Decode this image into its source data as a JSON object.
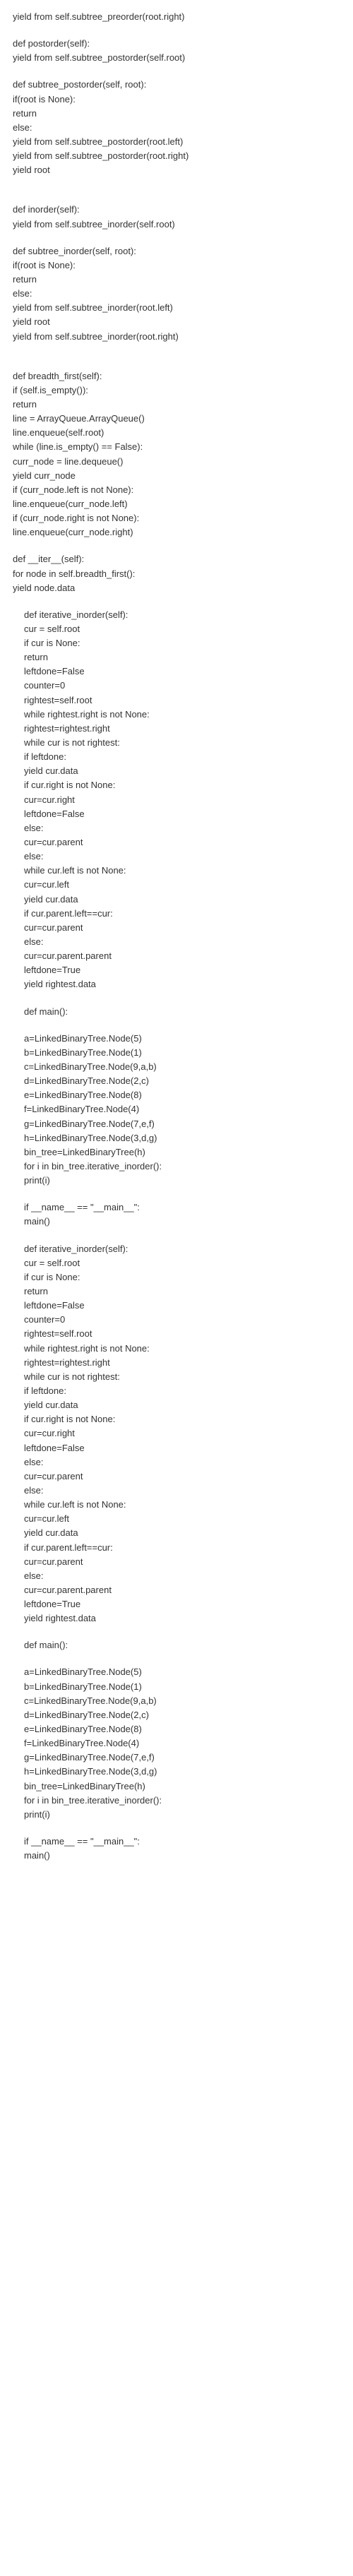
{
  "code": [
    {
      "t": "yield from self.subtree_preorder(root.right)",
      "i": 0
    },
    {
      "gap": true
    },
    {
      "t": "def postorder(self):",
      "i": 0
    },
    {
      "t": "yield from self.subtree_postorder(self.root)",
      "i": 0
    },
    {
      "gap": true
    },
    {
      "t": "def subtree_postorder(self, root):",
      "i": 0
    },
    {
      "t": "if(root is None):",
      "i": 0
    },
    {
      "t": "return",
      "i": 0
    },
    {
      "t": "else:",
      "i": 0
    },
    {
      "t": "yield from self.subtree_postorder(root.left)",
      "i": 0
    },
    {
      "t": "yield from self.subtree_postorder(root.right)",
      "i": 0
    },
    {
      "t": "yield root",
      "i": 0
    },
    {
      "gap": true
    },
    {
      "gap": true
    },
    {
      "t": "def inorder(self):",
      "i": 0
    },
    {
      "t": "yield from self.subtree_inorder(self.root)",
      "i": 0
    },
    {
      "gap": true
    },
    {
      "t": "def subtree_inorder(self, root):",
      "i": 0
    },
    {
      "t": "if(root is None):",
      "i": 0
    },
    {
      "t": "return",
      "i": 0
    },
    {
      "t": "else:",
      "i": 0
    },
    {
      "t": "yield from self.subtree_inorder(root.left)",
      "i": 0
    },
    {
      "t": "yield root",
      "i": 0
    },
    {
      "t": "yield from self.subtree_inorder(root.right)",
      "i": 0
    },
    {
      "gap": true
    },
    {
      "gap": true
    },
    {
      "t": "def breadth_first(self):",
      "i": 0
    },
    {
      "t": "if (self.is_empty()):",
      "i": 0
    },
    {
      "t": "return",
      "i": 0
    },
    {
      "t": "line = ArrayQueue.ArrayQueue()",
      "i": 0
    },
    {
      "t": "line.enqueue(self.root)",
      "i": 0
    },
    {
      "t": "while (line.is_empty() == False):",
      "i": 0
    },
    {
      "t": "curr_node = line.dequeue()",
      "i": 0
    },
    {
      "t": "yield curr_node",
      "i": 0
    },
    {
      "t": "if (curr_node.left is not None):",
      "i": 0
    },
    {
      "t": "line.enqueue(curr_node.left)",
      "i": 0
    },
    {
      "t": "if (curr_node.right is not None):",
      "i": 0
    },
    {
      "t": "line.enqueue(curr_node.right)",
      "i": 0
    },
    {
      "gap": true
    },
    {
      "t": "def __iter__(self):",
      "i": 0
    },
    {
      "t": "for node in self.breadth_first():",
      "i": 0
    },
    {
      "t": "yield node.data",
      "i": 0
    },
    {
      "gap": true
    },
    {
      "t": "def iterative_inorder(self):",
      "i": 1
    },
    {
      "t": "cur = self.root",
      "i": 1
    },
    {
      "t": "if cur is None:",
      "i": 1
    },
    {
      "t": "return",
      "i": 1
    },
    {
      "t": "leftdone=False",
      "i": 1
    },
    {
      "t": "counter=0",
      "i": 1
    },
    {
      "t": "rightest=self.root",
      "i": 1
    },
    {
      "t": "while rightest.right is not None:",
      "i": 1
    },
    {
      "t": "rightest=rightest.right",
      "i": 1
    },
    {
      "t": "while cur is not rightest:",
      "i": 1
    },
    {
      "t": "if leftdone:",
      "i": 1
    },
    {
      "t": "yield cur.data",
      "i": 1
    },
    {
      "t": "if cur.right is not None:",
      "i": 1
    },
    {
      "t": "cur=cur.right",
      "i": 1
    },
    {
      "t": "leftdone=False",
      "i": 1
    },
    {
      "t": "else:",
      "i": 1
    },
    {
      "t": "cur=cur.parent",
      "i": 1
    },
    {
      "t": "else:",
      "i": 1
    },
    {
      "t": "while cur.left is not None:",
      "i": 1
    },
    {
      "t": "cur=cur.left",
      "i": 1
    },
    {
      "t": "yield cur.data",
      "i": 1
    },
    {
      "t": "if cur.parent.left==cur:",
      "i": 1
    },
    {
      "t": "cur=cur.parent",
      "i": 1
    },
    {
      "t": "else:",
      "i": 1
    },
    {
      "t": "cur=cur.parent.parent",
      "i": 1
    },
    {
      "t": "leftdone=True",
      "i": 1
    },
    {
      "t": "yield rightest.data",
      "i": 1
    },
    {
      "gap": true
    },
    {
      "t": "def main():",
      "i": 1
    },
    {
      "gap": true
    },
    {
      "t": "a=LinkedBinaryTree.Node(5)",
      "i": 1
    },
    {
      "t": "b=LinkedBinaryTree.Node(1)",
      "i": 1
    },
    {
      "t": "c=LinkedBinaryTree.Node(9,a,b)",
      "i": 1
    },
    {
      "t": "d=LinkedBinaryTree.Node(2,c)",
      "i": 1
    },
    {
      "t": "e=LinkedBinaryTree.Node(8)",
      "i": 1
    },
    {
      "t": "f=LinkedBinaryTree.Node(4)",
      "i": 1
    },
    {
      "t": "g=LinkedBinaryTree.Node(7,e,f)",
      "i": 1
    },
    {
      "t": "h=LinkedBinaryTree.Node(3,d,g)",
      "i": 1
    },
    {
      "t": "bin_tree=LinkedBinaryTree(h)",
      "i": 1
    },
    {
      "t": "for i in bin_tree.iterative_inorder():",
      "i": 1
    },
    {
      "t": "print(i)",
      "i": 1
    },
    {
      "gap": true
    },
    {
      "t": "if __name__ == \"__main__\":",
      "i": 1
    },
    {
      "t": "main()",
      "i": 1
    },
    {
      "gap": true
    },
    {
      "t": "def iterative_inorder(self):",
      "i": 1
    },
    {
      "t": "cur = self.root",
      "i": 1
    },
    {
      "t": "if cur is None:",
      "i": 1
    },
    {
      "t": "return",
      "i": 1
    },
    {
      "t": "leftdone=False",
      "i": 1
    },
    {
      "t": "counter=0",
      "i": 1
    },
    {
      "t": "rightest=self.root",
      "i": 1
    },
    {
      "t": "while rightest.right is not None:",
      "i": 1
    },
    {
      "t": "rightest=rightest.right",
      "i": 1
    },
    {
      "t": "while cur is not rightest:",
      "i": 1
    },
    {
      "t": "if leftdone:",
      "i": 1
    },
    {
      "t": "yield cur.data",
      "i": 1
    },
    {
      "t": "if cur.right is not None:",
      "i": 1
    },
    {
      "t": "cur=cur.right",
      "i": 1
    },
    {
      "t": "leftdone=False",
      "i": 1
    },
    {
      "t": "else:",
      "i": 1
    },
    {
      "t": "cur=cur.parent",
      "i": 1
    },
    {
      "t": "else:",
      "i": 1
    },
    {
      "t": "while cur.left is not None:",
      "i": 1
    },
    {
      "t": "cur=cur.left",
      "i": 1
    },
    {
      "t": "yield cur.data",
      "i": 1
    },
    {
      "t": "if cur.parent.left==cur:",
      "i": 1
    },
    {
      "t": "cur=cur.parent",
      "i": 1
    },
    {
      "t": "else:",
      "i": 1
    },
    {
      "t": "cur=cur.parent.parent",
      "i": 1
    },
    {
      "t": "leftdone=True",
      "i": 1
    },
    {
      "t": "yield rightest.data",
      "i": 1
    },
    {
      "gap": true
    },
    {
      "t": "def main():",
      "i": 1
    },
    {
      "gap": true
    },
    {
      "t": "a=LinkedBinaryTree.Node(5)",
      "i": 1
    },
    {
      "t": "b=LinkedBinaryTree.Node(1)",
      "i": 1
    },
    {
      "t": "c=LinkedBinaryTree.Node(9,a,b)",
      "i": 1
    },
    {
      "t": "d=LinkedBinaryTree.Node(2,c)",
      "i": 1
    },
    {
      "t": "e=LinkedBinaryTree.Node(8)",
      "i": 1
    },
    {
      "t": "f=LinkedBinaryTree.Node(4)",
      "i": 1
    },
    {
      "t": "g=LinkedBinaryTree.Node(7,e,f)",
      "i": 1
    },
    {
      "t": "h=LinkedBinaryTree.Node(3,d,g)",
      "i": 1
    },
    {
      "t": "bin_tree=LinkedBinaryTree(h)",
      "i": 1
    },
    {
      "t": "for i in bin_tree.iterative_inorder():",
      "i": 1
    },
    {
      "t": "print(i)",
      "i": 1
    },
    {
      "gap": true
    },
    {
      "t": "if __name__ == \"__main__\":",
      "i": 1
    },
    {
      "t": "main()",
      "i": 1
    }
  ]
}
